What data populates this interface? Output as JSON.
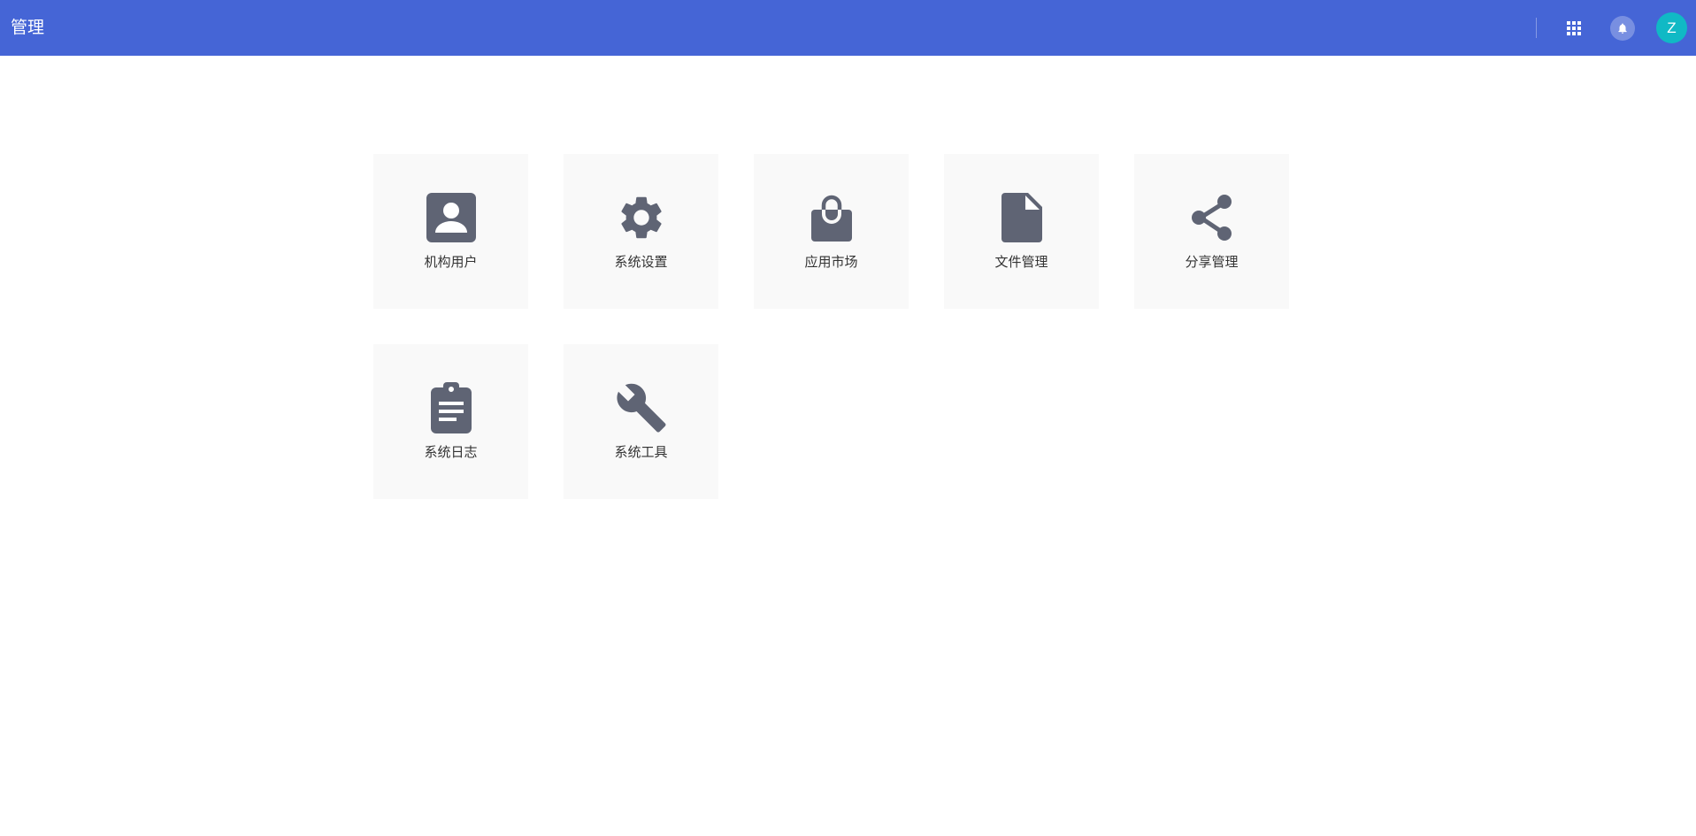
{
  "header": {
    "title": "管理",
    "avatar_initial": "Z",
    "colors": {
      "bar": "#4565d6",
      "avatar": "#10b9c5"
    },
    "icons": [
      "apps-grid-icon",
      "bell-icon"
    ]
  },
  "tiles": [
    {
      "label": "机构用户",
      "icon": "contact-card-icon"
    },
    {
      "label": "系统设置",
      "icon": "gear-icon"
    },
    {
      "label": "应用市场",
      "icon": "shopping-bag-icon"
    },
    {
      "label": "文件管理",
      "icon": "document-icon"
    },
    {
      "label": "分享管理",
      "icon": "share-icon"
    },
    {
      "label": "系统日志",
      "icon": "clipboard-log-icon"
    },
    {
      "label": "系统工具",
      "icon": "wrench-icon"
    }
  ],
  "colors": {
    "tile_bg": "#f9f9f9",
    "icon": "#5f6474",
    "label": "#333333"
  }
}
